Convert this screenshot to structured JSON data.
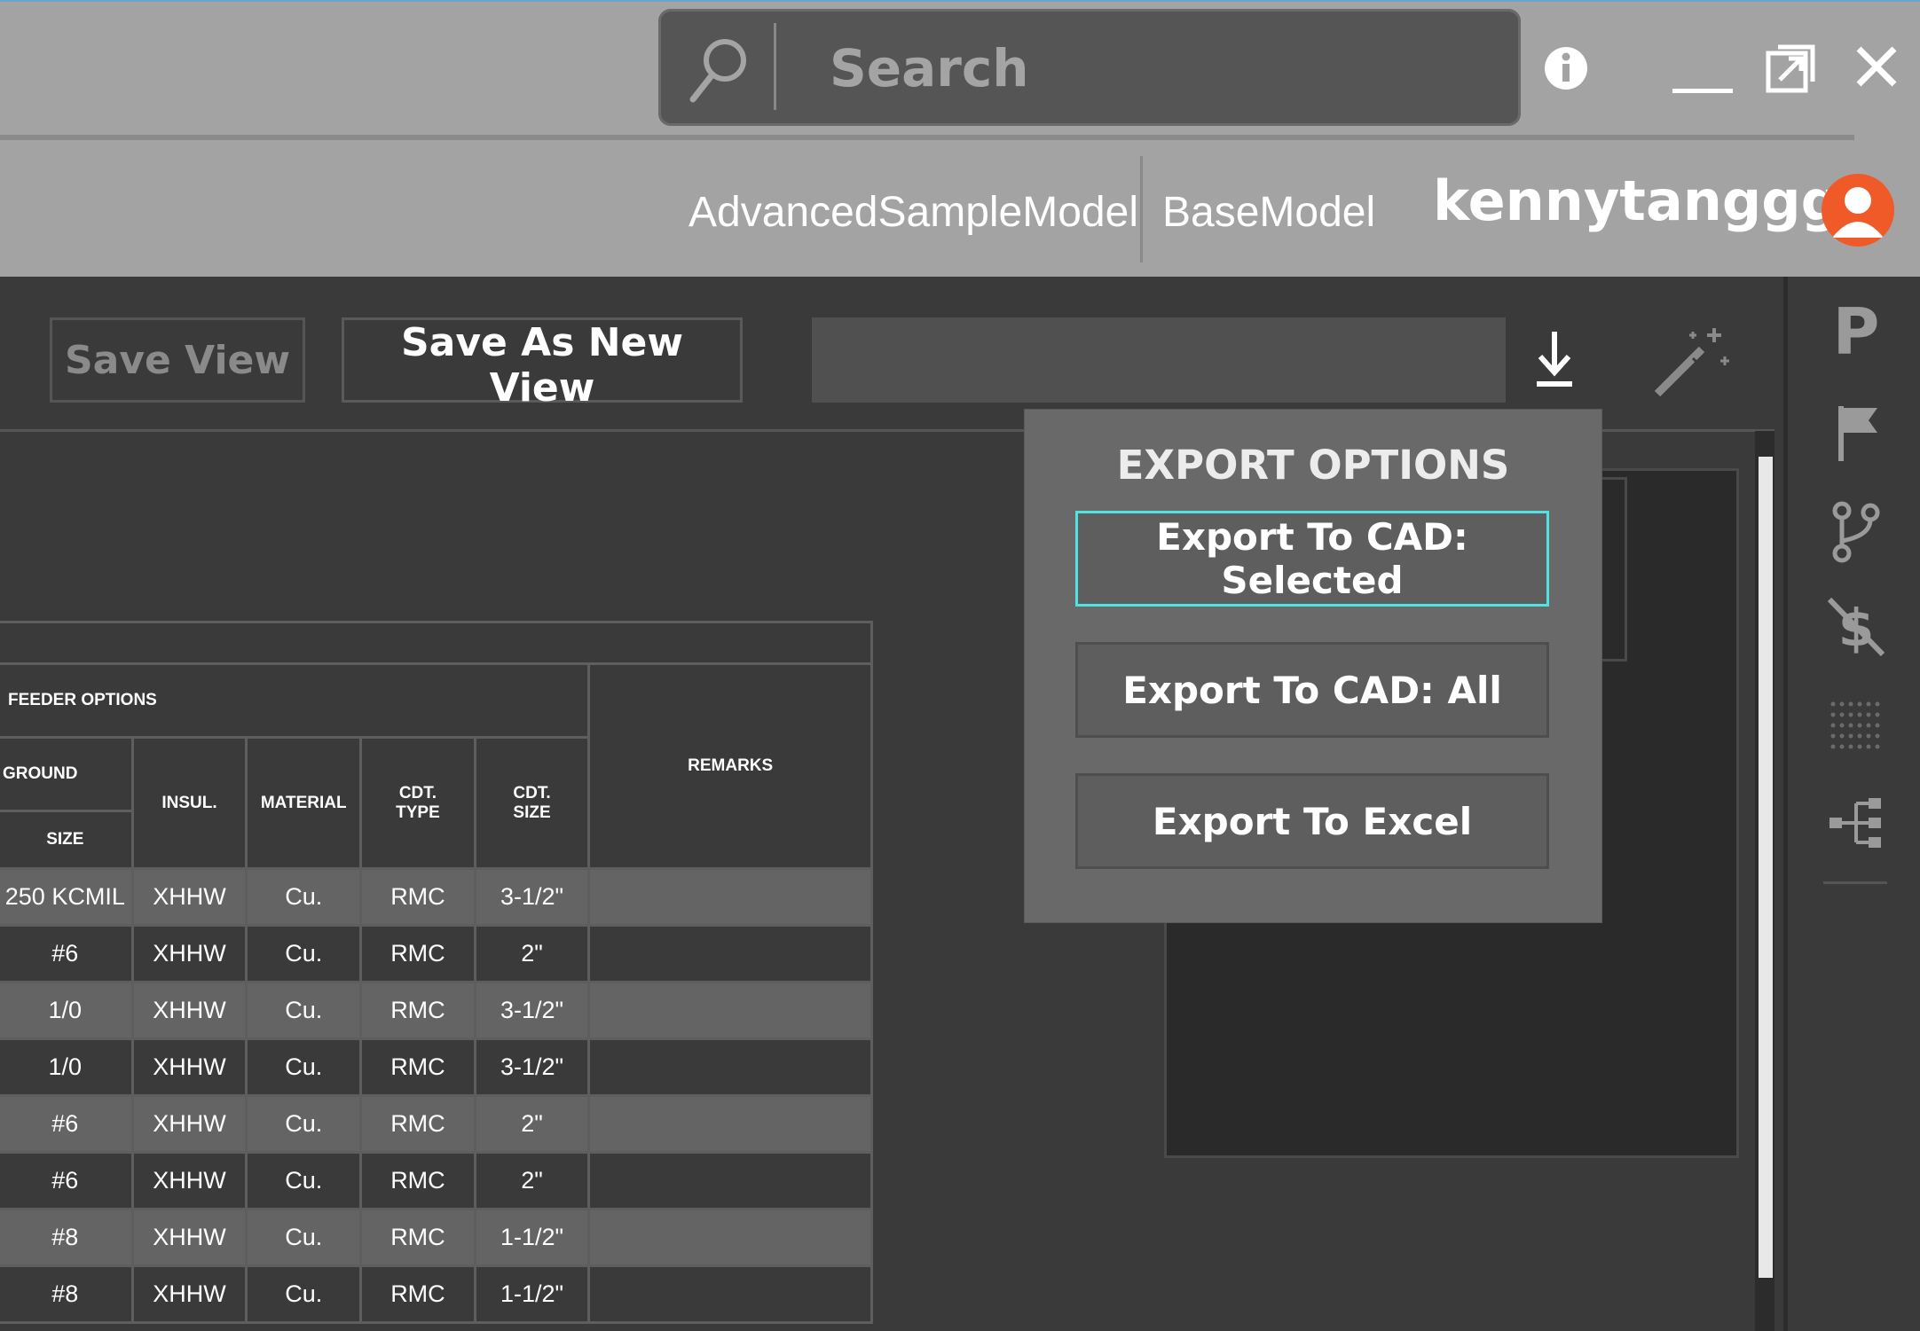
{
  "search": {
    "placeholder": "Search"
  },
  "header": {
    "model_name": "AdvancedSampleModel",
    "base_model": "BaseModel",
    "username": "kennytanggg"
  },
  "toolbar": {
    "save_view_label": "Save View",
    "save_as_new_label": "Save As New View",
    "view_name_value": ""
  },
  "export_menu": {
    "title": "EXPORT OPTIONS",
    "options": [
      "Export To CAD: Selected",
      "Export To CAD: All",
      "Export To Excel"
    ]
  },
  "table": {
    "group_header": "FEEDER OPTIONS",
    "ground_header": "GROUND",
    "columns": {
      "size": "SIZE",
      "insul": "INSUL.",
      "material": "MATERIAL",
      "cdt_type": "CDT. TYPE",
      "cdt_size": "CDT. SIZE",
      "remarks": "REMARKS"
    },
    "rows": [
      {
        "size": "250 KCMIL",
        "insul": "XHHW",
        "material": "Cu.",
        "cdt_type": "RMC",
        "cdt_size": "3-1/2\"",
        "remarks": ""
      },
      {
        "size": "#6",
        "insul": "XHHW",
        "material": "Cu.",
        "cdt_type": "RMC",
        "cdt_size": "2\"",
        "remarks": ""
      },
      {
        "size": "1/0",
        "insul": "XHHW",
        "material": "Cu.",
        "cdt_type": "RMC",
        "cdt_size": "3-1/2\"",
        "remarks": ""
      },
      {
        "size": "1/0",
        "insul": "XHHW",
        "material": "Cu.",
        "cdt_type": "RMC",
        "cdt_size": "3-1/2\"",
        "remarks": ""
      },
      {
        "size": "#6",
        "insul": "XHHW",
        "material": "Cu.",
        "cdt_type": "RMC",
        "cdt_size": "2\"",
        "remarks": ""
      },
      {
        "size": "#6",
        "insul": "XHHW",
        "material": "Cu.",
        "cdt_type": "RMC",
        "cdt_size": "2\"",
        "remarks": ""
      },
      {
        "size": "#8",
        "insul": "XHHW",
        "material": "Cu.",
        "cdt_type": "RMC",
        "cdt_size": "1-1/2\"",
        "remarks": ""
      },
      {
        "size": "#8",
        "insul": "XHHW",
        "material": "Cu.",
        "cdt_type": "RMC",
        "cdt_size": "1-1/2\"",
        "remarks": ""
      }
    ]
  },
  "right_rail": {
    "icons": [
      "p-icon",
      "flag-icon",
      "branch-icon",
      "no-cost-icon",
      "grid-icon",
      "hierarchy-icon"
    ],
    "p_label": "P"
  },
  "colors": {
    "titlebar": "#a3a3a3",
    "workspace": "#3a3a3a",
    "accent_focus": "#4fe3e3",
    "avatar": "#f05a28"
  }
}
